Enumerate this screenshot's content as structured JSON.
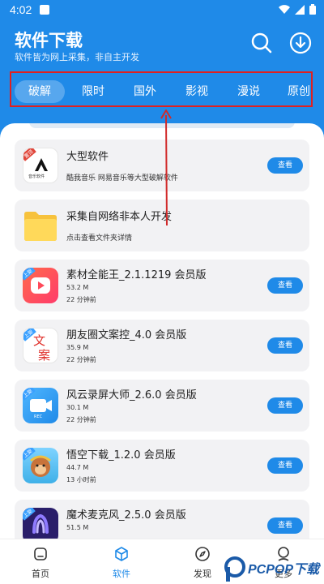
{
  "status": {
    "time": "4:02"
  },
  "app": {
    "title": "软件下载",
    "subtitle": "软件皆为网上采集，非自主开发"
  },
  "tabs": [
    {
      "label": "破解",
      "active": true
    },
    {
      "label": "限时"
    },
    {
      "label": "国外"
    },
    {
      "label": "影视"
    },
    {
      "label": "漫说"
    },
    {
      "label": "原创"
    }
  ],
  "cards": [
    {
      "title": "大型软件",
      "desc": "酷我音乐 网易音乐等大型破解软件",
      "button": "查看",
      "icon_badge": "置顶",
      "icon_text": "音乐软件"
    },
    {
      "title": "采集自网络非本人开发",
      "desc": "点击查看文件夹详情"
    },
    {
      "title": "素材全能王_2.1.1219 会员版",
      "size": "53.2 M",
      "time": "22 分钟前",
      "button": "查看",
      "icon_badge": "上架"
    },
    {
      "title": "朋友圈文案控_4.0 会员版",
      "size": "35.9 M",
      "time": "22 分钟前",
      "button": "查看",
      "icon_badge": "上架",
      "icon_text_1": "文",
      "icon_text_2": "案"
    },
    {
      "title": "风云录屏大师_2.6.0 会员版",
      "size": "30.1 M",
      "time": "22 分钟前",
      "button": "查看",
      "icon_badge": "上架",
      "icon_text": "REC"
    },
    {
      "title": "悟空下载_1.2.0 会员版",
      "size": "44.7 M",
      "time": "13 小时前",
      "button": "查看",
      "icon_badge": "上架"
    },
    {
      "title": "魔术麦克风_2.5.0 会员版",
      "size": "51.5 M",
      "time": "",
      "button": "查看",
      "icon_badge": "上架"
    }
  ],
  "nav": [
    {
      "label": "首页",
      "icon": "home-icon"
    },
    {
      "label": "软件",
      "icon": "box-icon",
      "active": true
    },
    {
      "label": "发现",
      "icon": "compass-icon"
    },
    {
      "label": "更多",
      "icon": "user-icon"
    }
  ],
  "watermark": {
    "text": "PCPOP下载"
  },
  "colors": {
    "primary": "#1f8ae8",
    "highlight_border": "#e02020",
    "arrow": "#d12a2a"
  }
}
